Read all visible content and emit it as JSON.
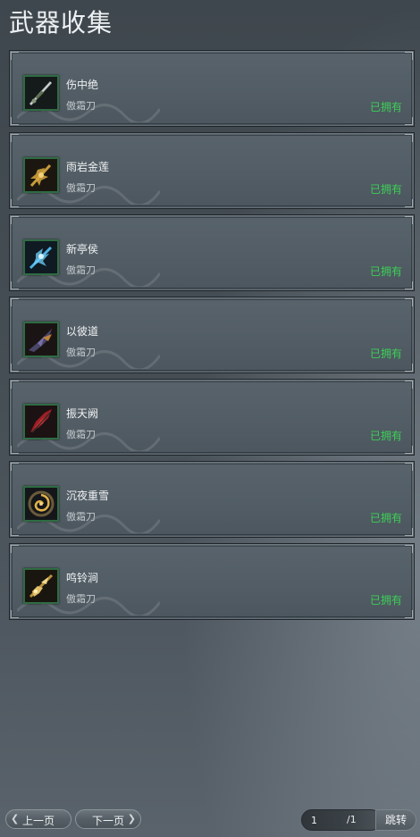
{
  "header": {
    "title": "武器收集"
  },
  "weapons": [
    {
      "name": "伤中绝",
      "type": "傲霜刀",
      "status": "已拥有",
      "icon": "sword-icon"
    },
    {
      "name": "雨岩金莲",
      "type": "傲霜刀",
      "status": "已拥有",
      "icon": "golden-lotus-blade-icon"
    },
    {
      "name": "新亭侯",
      "type": "傲霜刀",
      "status": "已拥有",
      "icon": "ice-blade-icon"
    },
    {
      "name": "以彼道",
      "type": "傲霜刀",
      "status": "已拥有",
      "icon": "dark-blade-icon"
    },
    {
      "name": "振天阙",
      "type": "傲霜刀",
      "status": "已拥有",
      "icon": "crimson-blade-icon"
    },
    {
      "name": "沉夜重雪",
      "type": "傲霜刀",
      "status": "已拥有",
      "icon": "vortex-ring-icon"
    },
    {
      "name": "鸣铃涧",
      "type": "傲霜刀",
      "status": "已拥有",
      "icon": "golden-blade-icon"
    }
  ],
  "pagination": {
    "prev_label": "上一页",
    "next_label": "下一页",
    "current_page": "1",
    "total_pages": "/1",
    "jump_label": "跳转"
  },
  "colors": {
    "owned": "#3ccf57",
    "icon_border": "#2f6b43"
  }
}
